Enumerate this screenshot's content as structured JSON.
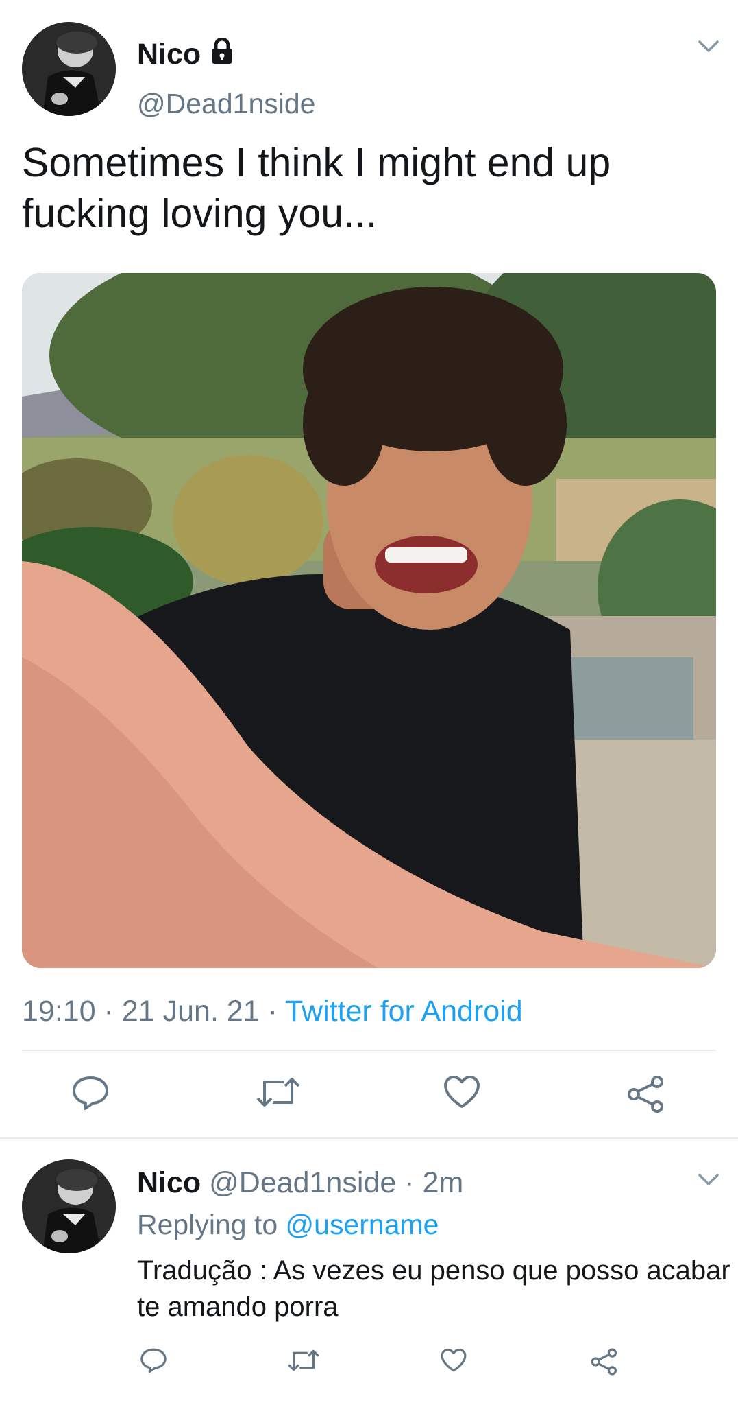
{
  "tweet": {
    "author_name": "Nico",
    "author_handle": "@Dead1nside",
    "text": "Sometimes I think I might end up fucking loving you...",
    "time": "19:10",
    "date": "21 Jun. 21",
    "separator": "·",
    "source": "Twitter for Android",
    "icons": {
      "lock": "lock-icon",
      "menu": "chevron-down-icon",
      "reply": "reply-icon",
      "retweet": "retweet-icon",
      "like": "heart-icon",
      "share": "share-icon"
    }
  },
  "reply": {
    "author_name": "Nico",
    "author_handle": "@Dead1nside",
    "age": "2m",
    "replying_label": "Replying to",
    "replying_to": "@username",
    "text": "Tradução : As vezes eu penso que posso acabar te amando porra"
  },
  "colors": {
    "text": "#14171a",
    "secondary": "#657786",
    "link": "#1da1f2",
    "divider": "#e6ecf0"
  }
}
